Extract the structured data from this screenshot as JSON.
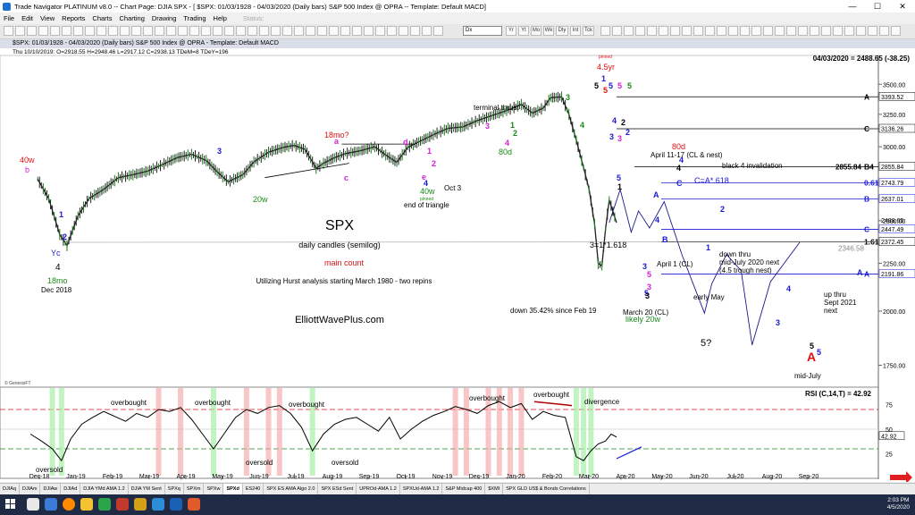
{
  "window": {
    "title": "Trade Navigator PLATINUM v8.0  --  Chart Page: DJIA SPX - [ $SPX: 01/03/1928 - 04/03/2020 (Daily bars)   S&P 500 Index @ OPRA  --  Template: Default MACD]",
    "minimize": "—",
    "maximize": "☐",
    "close": "✕"
  },
  "menu": {
    "items": [
      "File",
      "Edit",
      "View",
      "Reports",
      "Charts",
      "Charting",
      "Drawing",
      "Trading",
      "Help"
    ],
    "status": "Status:"
  },
  "toolbar": {
    "symbol_select": "Dx",
    "buttons": [
      "Yr",
      "Yt",
      "Mo",
      "Wk",
      "Dly",
      "Int",
      "Tck"
    ]
  },
  "chart_header": {
    "text": "$SPX:  01/03/1928 - 04/03/2020  (Daily bars)   S&P 500 Index @ OPRA  -  Template: Default MACD",
    "bar_info": "Thu   10/10/2019:  O=2918.55   H=2948.46   L=2917.12   C=2938.13   TDeM=8   TDeY=196"
  },
  "chart_data": {
    "type": "line",
    "title": "SPX",
    "subtitle": "daily candles (semilog)",
    "main_count_label": "main count",
    "note": "Utilizing Hurst analysis starting March 1980 - two repins",
    "watermark": "ElliottWavePlus.com",
    "price_label": "04/03/2020 = 2488.65 (-38.25)",
    "yaxis_ticks": [
      3500,
      3250,
      3000,
      2750,
      2500,
      2250,
      2000,
      1750
    ],
    "ylim": [
      1680,
      3660
    ],
    "x_ticks": [
      "Dec-18",
      "Jan-19",
      "Feb-19",
      "Mar-19",
      "Apr-19",
      "May-19",
      "Jun-19",
      "Jul-19",
      "Aug-19",
      "Sep-19",
      "Oct-19",
      "Nov-19",
      "Dec-19",
      "Jan-20",
      "Feb-20",
      "Mar-20",
      "Apr-20",
      "May-20",
      "Jun-20",
      "Jul-20",
      "Aug-20",
      "Sep-20"
    ],
    "x_positions_months": [
      0,
      1,
      2,
      3,
      4,
      5,
      6,
      7,
      8,
      9,
      10,
      11,
      12,
      13,
      14,
      15,
      16,
      17,
      18,
      19,
      20,
      21
    ],
    "price_series": {
      "name": "SPX",
      "x_months": [
        0.2,
        0.5,
        0.8,
        1.0,
        1.3,
        1.6,
        2.0,
        2.4,
        2.8,
        3.2,
        3.6,
        4.0,
        4.4,
        4.8,
        5.1,
        5.4,
        5.8,
        6.1,
        6.5,
        6.9,
        7.2,
        7.5,
        7.8,
        8.0,
        8.3,
        8.6,
        9.0,
        9.4,
        9.7,
        10.0,
        10.3,
        10.7,
        11.0,
        11.4,
        11.8,
        12.2,
        12.6,
        13.0,
        13.4,
        13.7,
        14.0,
        14.2,
        14.5,
        14.7,
        14.9,
        15.1,
        15.25,
        15.4,
        15.5,
        15.6,
        15.7,
        15.8,
        16.0
      ],
      "values": [
        2770,
        2640,
        2416,
        2351,
        2530,
        2640,
        2700,
        2780,
        2800,
        2825,
        2870,
        2920,
        2945,
        2900,
        2820,
        2752,
        2800,
        2890,
        2960,
        2995,
        3010,
        2980,
        2845,
        2880,
        2920,
        2950,
        2970,
        3000,
        2940,
        2887,
        2995,
        3050,
        3090,
        3140,
        3150,
        3200,
        3240,
        3280,
        3330,
        3260,
        3300,
        3386,
        3393,
        3250,
        3050,
        2850,
        2700,
        2480,
        2250,
        2237,
        2450,
        2630,
        2488
      ]
    },
    "levels": [
      {
        "label": "A",
        "value": 3393.52,
        "value_label": "3393.52"
      },
      {
        "label": "C",
        "value": 3136.26,
        "value_label": "3136.26"
      },
      {
        "label": "B4",
        "value": 2855.84,
        "value_label": "2855.84",
        "left_label": "2855.84"
      },
      {
        "label": "0.618",
        "value": 2743.79,
        "value_label": "2743.79"
      },
      {
        "label": "B",
        "value": 2637.01,
        "value_label": "2637.01"
      },
      {
        "label": "C",
        "value": 2447.49,
        "value_label": "2447.49"
      },
      {
        "label": "1.618",
        "value": 2372.45,
        "value_label": "2372.45"
      },
      {
        "label": "A",
        "value": 2191.86,
        "value_label": "2191.86"
      }
    ],
    "extra_price_labels": [
      "2488.65",
      "2346.58"
    ],
    "annotations": {
      "left_40w": "40w",
      "left_b": "b",
      "yc": "Yc",
      "wave4": "4",
      "mo18": "18mo",
      "dec2018": "Dec 2018",
      "w20": "20w",
      "mo18q": "18mo?",
      "w40": "40w",
      "pinned1": "pinned",
      "end_triangle": "end of triangle",
      "oct3": "Oct 3",
      "terminal": "terminal thrust",
      "d80_1": "80d",
      "yr45_pinned": "pinned",
      "yr45": "4.5yr",
      "april11_17": "April 11-17 (CL & nest)",
      "d80_2": "80d",
      "black4": "black 4 invalidation",
      "ca618": "C=A*.618",
      "fib": "3=1*1.618",
      "april1": "April 1 (CL)",
      "downthru": "down thru",
      "midjuly2020": "mid-July 2020 next",
      "trough45": "(4.5 trough nest)",
      "earlymay": "early May",
      "down3542": "down 35.42% since Feb 19",
      "march20": "March 20 (CL)",
      "likely20w": "likely 20w",
      "q5": "5?",
      "upthru": "up thru",
      "sept2021": "Sept 2021",
      "next": "next",
      "midjuly": "mid-July",
      "bigA": "A",
      "copyright": "© GenesisFT"
    },
    "rsi": {
      "label": "RSI (C,14,T) = 42.92",
      "ylim": [
        10,
        90
      ],
      "ticks": [
        75,
        50,
        25
      ],
      "overbought_level": 70,
      "oversold_level": 30,
      "current": "42.92",
      "x_months": [
        0.0,
        0.3,
        0.6,
        0.85,
        1.1,
        1.4,
        1.7,
        2.0,
        2.3,
        2.6,
        2.9,
        3.2,
        3.5,
        3.8,
        4.1,
        4.4,
        4.7,
        5.0,
        5.3,
        5.6,
        5.9,
        6.2,
        6.5,
        6.8,
        7.1,
        7.4,
        7.7,
        8.0,
        8.3,
        8.6,
        8.9,
        9.2,
        9.5,
        9.8,
        10.1,
        10.4,
        10.7,
        11.0,
        11.3,
        11.6,
        11.9,
        12.2,
        12.5,
        12.8,
        13.1,
        13.4,
        13.7,
        14.0,
        14.3,
        14.6,
        14.9,
        15.1,
        15.3,
        15.5,
        15.7,
        15.85,
        16.0
      ],
      "values": [
        45,
        38,
        30,
        18,
        40,
        55,
        62,
        68,
        63,
        58,
        66,
        62,
        70,
        68,
        72,
        60,
        45,
        30,
        46,
        62,
        70,
        66,
        72,
        74,
        66,
        52,
        28,
        45,
        55,
        60,
        62,
        55,
        48,
        62,
        40,
        50,
        58,
        64,
        68,
        73,
        70,
        66,
        74,
        78,
        72,
        76,
        60,
        68,
        64,
        62,
        22,
        18,
        28,
        35,
        38,
        45,
        42
      ],
      "annotations": {
        "ob1": "overbought",
        "ob2": "overbought",
        "ob3": "overbought",
        "ob4": "overbought",
        "ob5": "overbought",
        "os1": "oversold",
        "os2": "oversold",
        "os3": "oversold",
        "divergence": "divergence"
      }
    },
    "colors": {
      "blue": "#1a1ad6",
      "red": "#e01010",
      "green": "#1a8a1a",
      "magenta": "#d51fd5",
      "ob_band": "#f4a0a0",
      "os_band": "#a8f0a8"
    }
  },
  "tabs": [
    "DJIAq",
    "DJIAm",
    "DJIAw",
    "DJIAd",
    "DJIA YMd AMA 1.2",
    "DJIA YM Sent",
    "SPXq",
    "SPXm",
    "SPXw",
    "SPXd",
    "ES240",
    "SPX ES AMA Algo 2.0",
    "SPX ESd Sent",
    "UPROd-AMA 1.2",
    "SPXUd-AMA 1.2",
    "S&P Midcap 400",
    "$XMI",
    "SPX GLD US$ & Bonds Correlations"
  ],
  "active_tab": "SPXd",
  "taskbar": {
    "time": "2:03 PM",
    "date": "4/5/2020"
  }
}
